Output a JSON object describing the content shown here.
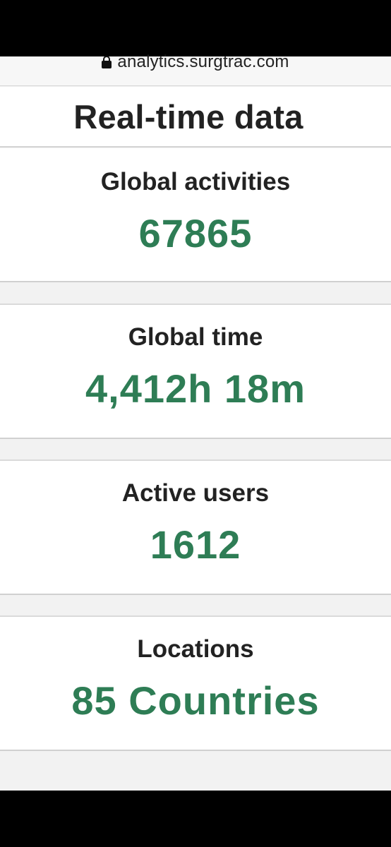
{
  "browser": {
    "url": "analytics.surgtrac.com"
  },
  "header": {
    "title": "Real-time data"
  },
  "stats": [
    {
      "label": "Global activities",
      "value": "67865"
    },
    {
      "label": "Global time",
      "value": "4,412h 18m"
    },
    {
      "label": "Active users",
      "value": "1612"
    },
    {
      "label": "Locations",
      "value": "85 Countries"
    }
  ],
  "colors": {
    "accent": "#2e7d55",
    "text": "#222222",
    "background": "#f2f2f2"
  }
}
